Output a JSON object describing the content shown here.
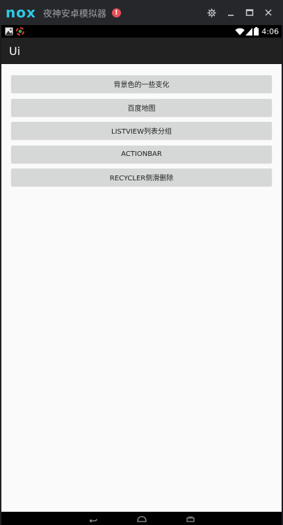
{
  "emulator": {
    "logo": "nox",
    "title": "夜神安卓模拟器",
    "alert": "!",
    "controls": [
      "gear-icon",
      "minimize-icon",
      "maximize-icon",
      "close-icon"
    ]
  },
  "statusbar": {
    "time": "4:06",
    "left_icons": [
      "gallery-notification-icon",
      "app-notification-icon"
    ],
    "right_icons": [
      "wifi-icon",
      "signal-icon",
      "battery-icon"
    ]
  },
  "actionbar": {
    "title": "Ui"
  },
  "buttons": [
    {
      "label": "背景色的一些变化"
    },
    {
      "label": "百度地图"
    },
    {
      "label": "LISTVIEW列表分组"
    },
    {
      "label": "ACTIONBAR"
    },
    {
      "label": "RECYCLER侧滑删除"
    }
  ],
  "navbar": {
    "buttons": [
      "back-icon",
      "home-icon",
      "recents-icon"
    ]
  },
  "colors": {
    "accent": "#2ec9e6",
    "actionbar": "#212121",
    "content_bg": "#fafafa",
    "button_bg": "#d6d7d7",
    "alert": "#e84f5a"
  }
}
